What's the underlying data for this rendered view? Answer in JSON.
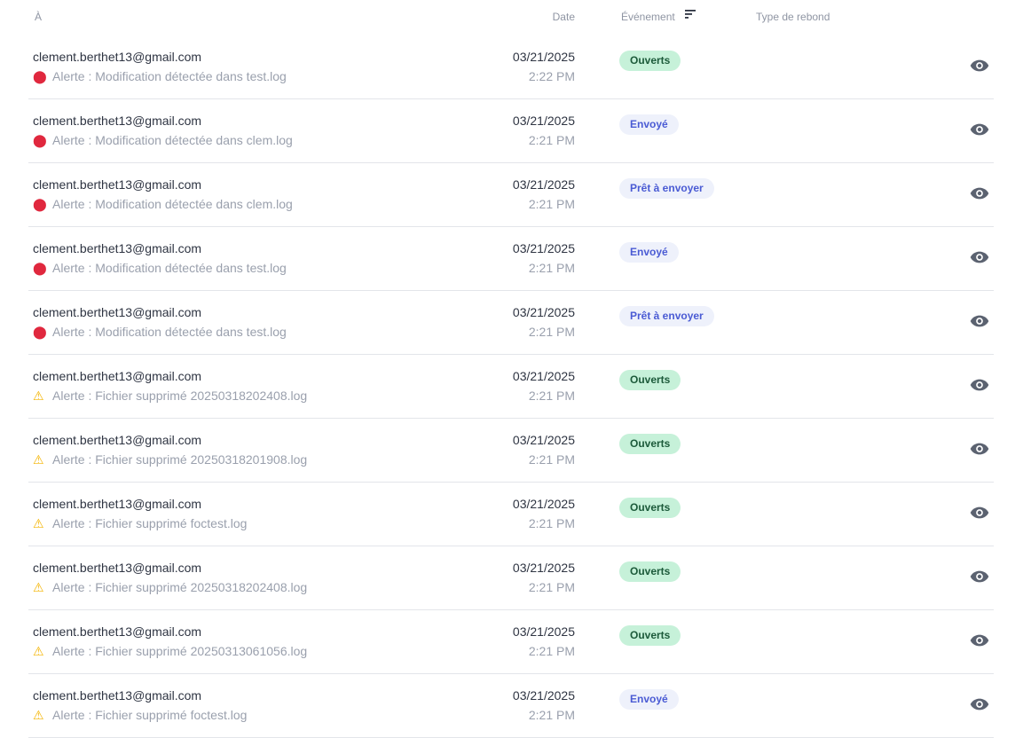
{
  "columns": {
    "to": "À",
    "date": "Date",
    "event": "Événement",
    "bounce_type": "Type de rebond"
  },
  "rows": [
    {
      "to": "clement.berthet13@gmail.com",
      "icon": "siren-icon",
      "subject": "Alerte : Modification détectée dans test.log",
      "date": "03/21/2025",
      "time": "2:22 PM",
      "event": "Ouverts",
      "event_kind": "open"
    },
    {
      "to": "clement.berthet13@gmail.com",
      "icon": "siren-icon",
      "subject": "Alerte : Modification détectée dans clem.log",
      "date": "03/21/2025",
      "time": "2:21 PM",
      "event": "Envoyé",
      "event_kind": "sent"
    },
    {
      "to": "clement.berthet13@gmail.com",
      "icon": "siren-icon",
      "subject": "Alerte : Modification détectée dans clem.log",
      "date": "03/21/2025",
      "time": "2:21 PM",
      "event": "Prêt à envoyer",
      "event_kind": "ready"
    },
    {
      "to": "clement.berthet13@gmail.com",
      "icon": "siren-icon",
      "subject": "Alerte : Modification détectée dans test.log",
      "date": "03/21/2025",
      "time": "2:21 PM",
      "event": "Envoyé",
      "event_kind": "sent"
    },
    {
      "to": "clement.berthet13@gmail.com",
      "icon": "siren-icon",
      "subject": "Alerte : Modification détectée dans test.log",
      "date": "03/21/2025",
      "time": "2:21 PM",
      "event": "Prêt à envoyer",
      "event_kind": "ready"
    },
    {
      "to": "clement.berthet13@gmail.com",
      "icon": "warning-icon",
      "subject": "Alerte : Fichier supprimé 20250318202408.log",
      "date": "03/21/2025",
      "time": "2:21 PM",
      "event": "Ouverts",
      "event_kind": "open"
    },
    {
      "to": "clement.berthet13@gmail.com",
      "icon": "warning-icon",
      "subject": "Alerte : Fichier supprimé 20250318201908.log",
      "date": "03/21/2025",
      "time": "2:21 PM",
      "event": "Ouverts",
      "event_kind": "open"
    },
    {
      "to": "clement.berthet13@gmail.com",
      "icon": "warning-icon",
      "subject": "Alerte : Fichier supprimé foctest.log",
      "date": "03/21/2025",
      "time": "2:21 PM",
      "event": "Ouverts",
      "event_kind": "open"
    },
    {
      "to": "clement.berthet13@gmail.com",
      "icon": "warning-icon",
      "subject": "Alerte : Fichier supprimé 20250318202408.log",
      "date": "03/21/2025",
      "time": "2:21 PM",
      "event": "Ouverts",
      "event_kind": "open"
    },
    {
      "to": "clement.berthet13@gmail.com",
      "icon": "warning-icon",
      "subject": "Alerte : Fichier supprimé 20250313061056.log",
      "date": "03/21/2025",
      "time": "2:21 PM",
      "event": "Ouverts",
      "event_kind": "open"
    },
    {
      "to": "clement.berthet13@gmail.com",
      "icon": "warning-icon",
      "subject": "Alerte : Fichier supprimé foctest.log",
      "date": "03/21/2025",
      "time": "2:21 PM",
      "event": "Envoyé",
      "event_kind": "sent"
    }
  ]
}
